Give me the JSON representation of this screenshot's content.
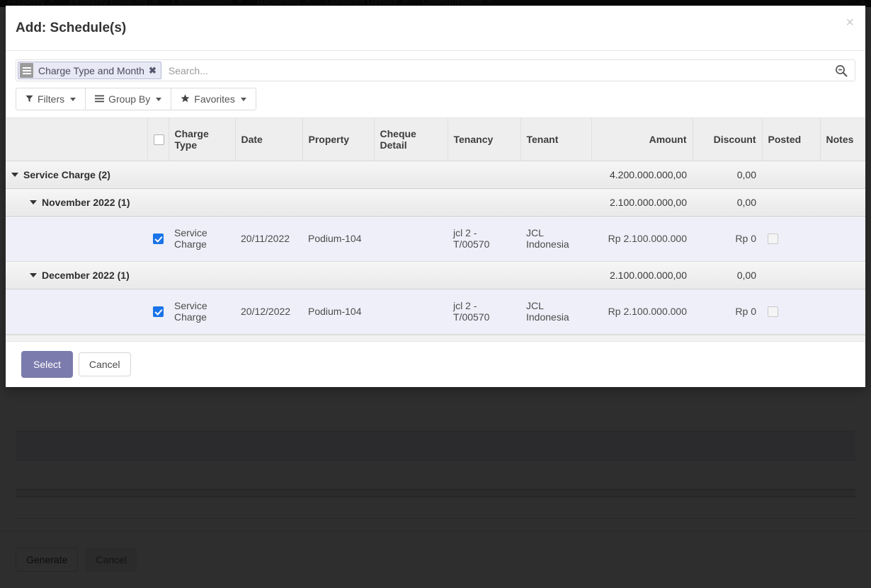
{
  "topnav": {
    "items": [
      {
        "label": "Property"
      },
      {
        "label": "Property Booking"
      },
      {
        "label": "Commissions"
      },
      {
        "label": "Reporting"
      },
      {
        "label": "Landlord Details"
      },
      {
        "label": "Configuration"
      }
    ],
    "right_icons": [
      "clock-icon",
      "help-icon",
      "messages-icon",
      "user-icon"
    ]
  },
  "modal": {
    "title": "Add: Schedule(s)",
    "close_label": "×",
    "search": {
      "facet_label": "Charge Type and Month",
      "facet_remove_label": "✖",
      "placeholder": "Search...",
      "value": "",
      "search_icon": "magnifier-minus-icon"
    },
    "controls": [
      {
        "name": "filters",
        "label": "Filters",
        "icon": "funnel-icon"
      },
      {
        "name": "group-by",
        "label": "Group By",
        "icon": "list-icon"
      },
      {
        "name": "favorites",
        "label": "Favorites",
        "icon": "star-icon"
      }
    ],
    "table": {
      "columns": [
        {
          "key": "spacer",
          "label": ""
        },
        {
          "key": "select",
          "label": ""
        },
        {
          "key": "charge_type",
          "label": "Charge Type"
        },
        {
          "key": "date",
          "label": "Date"
        },
        {
          "key": "property",
          "label": "Property"
        },
        {
          "key": "cheque_detail",
          "label": "Cheque Detail"
        },
        {
          "key": "tenancy",
          "label": "Tenancy"
        },
        {
          "key": "tenant",
          "label": "Tenant"
        },
        {
          "key": "amount",
          "label": "Amount"
        },
        {
          "key": "discount",
          "label": "Discount"
        },
        {
          "key": "posted",
          "label": "Posted"
        },
        {
          "key": "notes",
          "label": "Notes"
        }
      ],
      "rows": [
        {
          "kind": "group",
          "level": 1,
          "label": "Service Charge (2)",
          "amount": "4.200.000.000,00",
          "discount": "0,00"
        },
        {
          "kind": "group",
          "level": 2,
          "label": "November 2022 (1)",
          "amount": "2.100.000.000,00",
          "discount": "0,00"
        },
        {
          "kind": "record",
          "selected": true,
          "charge_type": "Service Charge",
          "date": "20/11/2022",
          "property": "Podium-104",
          "cheque_detail": "",
          "tenancy": "jcl 2 - T/00570",
          "tenant": "JCL Indonesia",
          "amount": "Rp 2.100.000.000",
          "discount": "Rp 0",
          "posted": false,
          "notes": ""
        },
        {
          "kind": "group",
          "level": 2,
          "label": "December 2022 (1)",
          "amount": "2.100.000.000,00",
          "discount": "0,00"
        },
        {
          "kind": "record",
          "selected": true,
          "charge_type": "Service Charge",
          "date": "20/12/2022",
          "property": "Podium-104",
          "cheque_detail": "",
          "tenancy": "jcl 2 - T/00570",
          "tenant": "JCL Indonesia",
          "amount": "Rp 2.100.000.000",
          "discount": "Rp 0",
          "posted": false,
          "notes": ""
        }
      ],
      "select_all_checked": false
    },
    "footer": {
      "select_label": "Select",
      "cancel_label": "Cancel"
    }
  },
  "background_form": {
    "footer": {
      "generate_label": "Generate",
      "cancel_label": "Cancel"
    }
  },
  "colors": {
    "primary": "#7c7bad",
    "row_highlight": "#eeeff8",
    "facet_bg": "#e8e9f5",
    "checkbox_checked": "#1a73e8"
  }
}
